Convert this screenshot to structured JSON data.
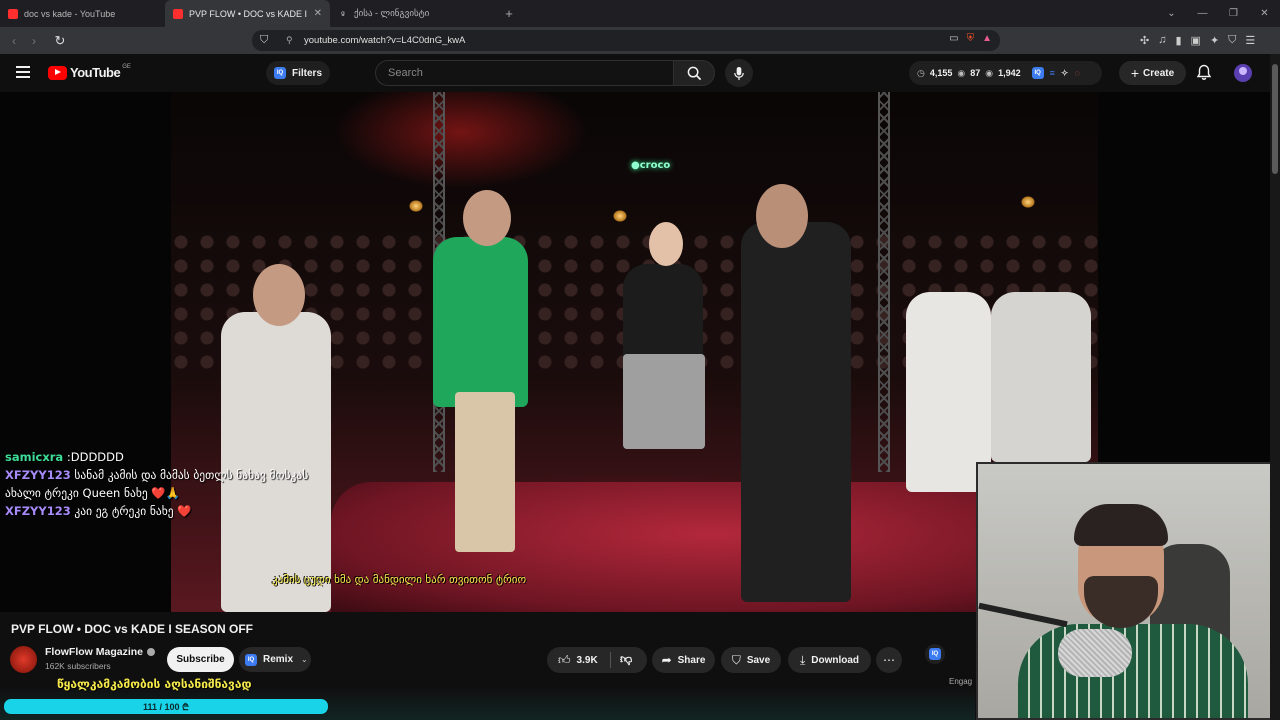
{
  "browser": {
    "tabs": [
      {
        "title": "doc vs kade - YouTube",
        "active": false,
        "favicon": "youtube-icon"
      },
      {
        "title": "PVP FLOW • DOC vs KADE I SEASON OFF",
        "active": true,
        "favicon": "youtube-icon"
      },
      {
        "title": "ქისა - ლინგვისტი",
        "active": false,
        "favicon": "g-icon"
      }
    ],
    "tab_close": "✕",
    "new_tab": "+",
    "url": "youtube.com/watch?v=L4C0dnG_kwA"
  },
  "youtube": {
    "logo_text": "YouTube",
    "country_code": "GE",
    "filters_label": "Filters",
    "search_placeholder": "Search",
    "stats": {
      "views": "4,155",
      "watching": "87",
      "likes": "1,942"
    },
    "create_label": "Create"
  },
  "video": {
    "neon_sign": "●croco",
    "subtitle": "კამის ცუდი ხმა და მანდილი ხარ თვითონ ტრიო",
    "chat": [
      {
        "user": "samicxra",
        "message": ":DDDDDD",
        "color": "#3ddc97"
      },
      {
        "user": "XFZYY123",
        "message": "სანამ კამის და მამას ბეთლს ნახავ მოსკას ახალი ტრეკი Queen ნახე ❤️🙏",
        "color": "#a78bfa"
      },
      {
        "user": "XFZYY123",
        "message": "კაი ეგ ტრეკი ნახე ❤️",
        "color": "#a78bfa"
      }
    ]
  },
  "info": {
    "title": "PVP FLOW • DOC vs KADE I SEASON OFF",
    "channel_name": "FlowFlow Magazine",
    "subscribers": "162K subscribers",
    "subscribe_label": "Subscribe",
    "remix_label": "Remix",
    "like_count": "3.9K",
    "share_label": "Share",
    "save_label": "Save",
    "download_label": "Download",
    "engagement_label": "Engag"
  },
  "overlay": {
    "scroll_text": "წყალკამკამობის აღსანიშნავად",
    "goal_text": "111 / 100 ₾",
    "goal_fraction": 1.0
  },
  "colors": {
    "accent_red": "#ff0000",
    "goal_bar": "#19d4e8",
    "subtitle_yellow": "#f5e94a"
  }
}
